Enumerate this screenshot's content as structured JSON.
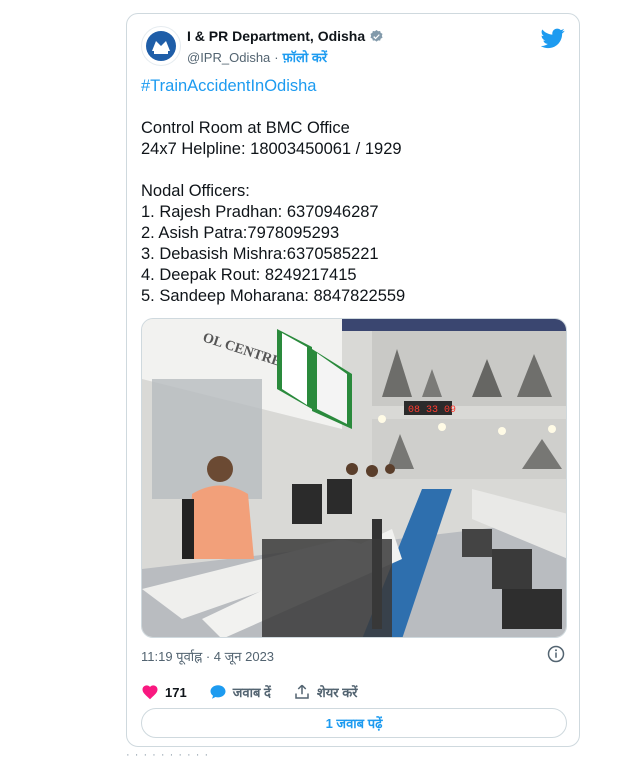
{
  "tweet": {
    "author_name": "I & PR Department, Odisha",
    "handle": "@IPR_Odisha",
    "separator": "·",
    "follow_label": "फ़ॉलो करें",
    "hashtag": "#TrainAccidentInOdisha",
    "lines": [
      "Control Room at BMC Office",
      "24x7 Helpline: 18003450061 / 1929",
      "",
      "Nodal Officers:",
      "1. Rajesh Pradhan: 6370946287",
      "2. Asish Patra:7978095293",
      "3. Debasish Mishra:6370585221",
      "4. Deepak Rout: 8249217415",
      "5. Sandeep Moharana: 8847822559"
    ],
    "photo": {
      "wall_sign": "OL CENTRE",
      "clock": "08 33 09"
    },
    "timestamp": "11:19 पूर्वाह्न · 4 जून 2023",
    "actions": {
      "likes": "171",
      "reply_label": "जवाब दें",
      "share_label": "शेयर करें"
    },
    "replies_button": "1 जवाब पढ़ें"
  },
  "colors": {
    "accent": "#1d9bf0",
    "like": "#f91880",
    "text": "#0f1419",
    "secondary": "#536471"
  },
  "below_text": "· · ·  ·  ·  ·  ·  · · ·"
}
